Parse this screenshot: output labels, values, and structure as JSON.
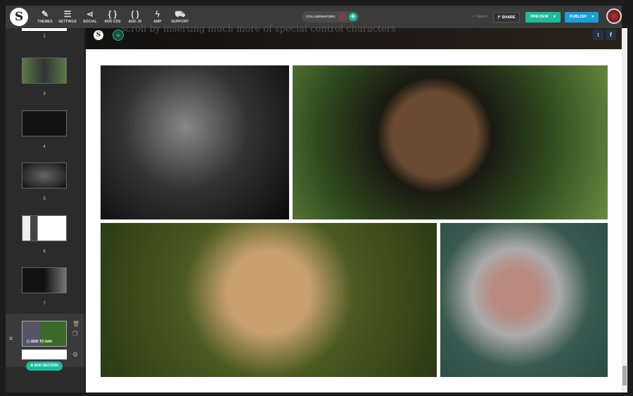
{
  "toolbar": {
    "logo": "S",
    "tools": [
      {
        "icon": "brush-icon",
        "glyph": "✎",
        "label": "THEMES"
      },
      {
        "icon": "list-icon",
        "glyph": "☰",
        "label": "SETTINGS"
      },
      {
        "icon": "share-nodes-icon",
        "glyph": "⋖",
        "label": "SOCIAL"
      },
      {
        "icon": "braces-icon",
        "glyph": "{ }",
        "label": "ADD CSS"
      },
      {
        "icon": "parens-icon",
        "glyph": "( )",
        "label": "ADD JS"
      },
      {
        "icon": "bolt-icon",
        "glyph": "ϟ",
        "label": "AMP"
      },
      {
        "icon": "ambulance-icon",
        "glyph": "⛟",
        "label": "SUPPORT"
      }
    ],
    "collaborators_label": "COLLABORATORS:",
    "saved": "✓ Saved",
    "share": "SHARE",
    "preview": "PREVIEW",
    "publish": "PUBLISH"
  },
  "sidebar": {
    "sections": [
      "2",
      "3",
      "4",
      "5",
      "6",
      "7"
    ],
    "add_to_nav": "ADD TO NAV",
    "add_section": "ADD SECTION"
  },
  "content": {
    "faded_text": "scroll by inserting much more of special control characters",
    "social": [
      "twitter",
      "facebook"
    ]
  },
  "colors": {
    "accent": "#1bbc9b",
    "publish": "#1a9fd6"
  }
}
